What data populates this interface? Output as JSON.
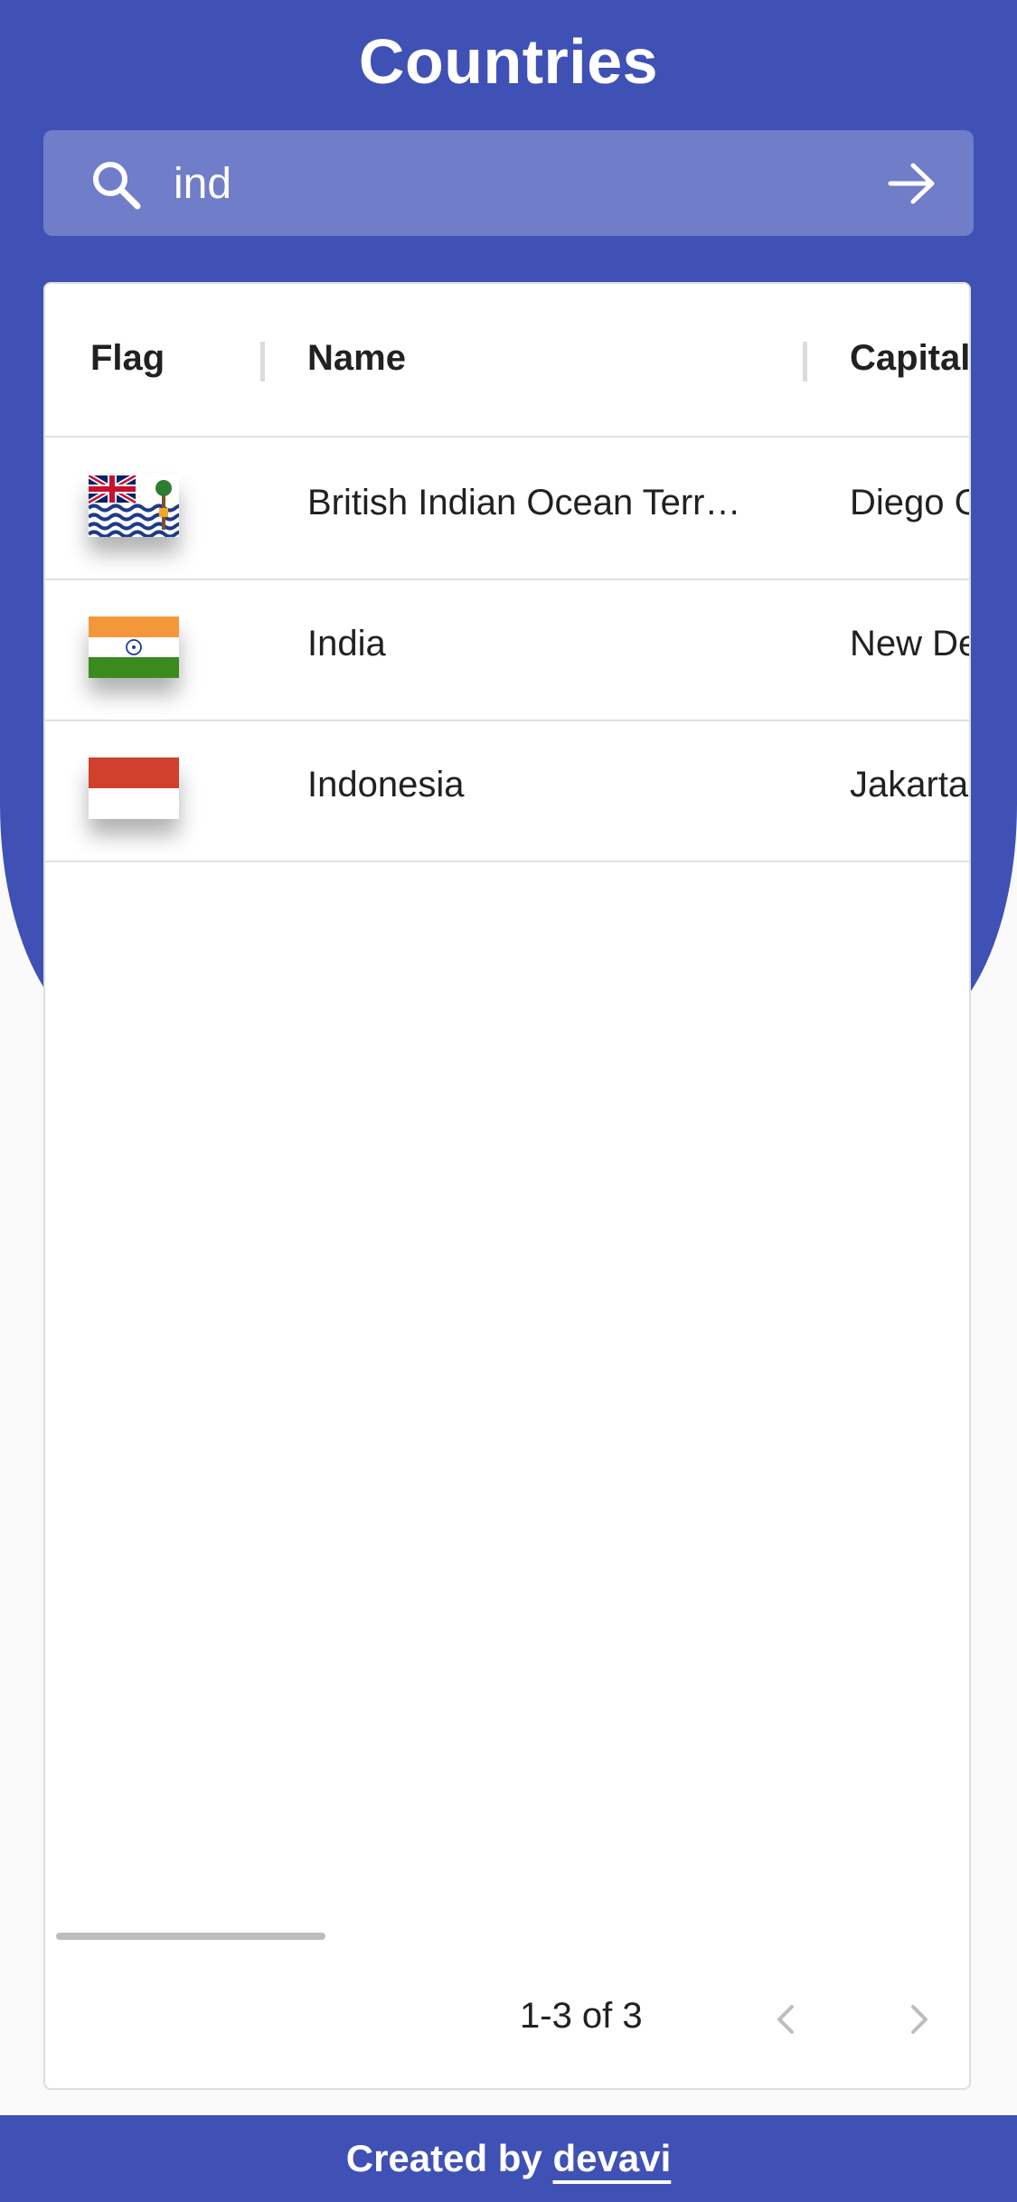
{
  "app": {
    "title": "Countries"
  },
  "search": {
    "value": "ind"
  },
  "table": {
    "columns": [
      "Flag",
      "Name",
      "Capital"
    ],
    "rows": [
      {
        "flag": "british-indian-ocean-territory-flag",
        "name": "British Indian Ocean Terr…",
        "capital": "Diego G"
      },
      {
        "flag": "india-flag",
        "name": "India",
        "capital": "New De"
      },
      {
        "flag": "indonesia-flag",
        "name": "Indonesia",
        "capital": "Jakarta"
      }
    ]
  },
  "pagination": {
    "range": "1-3 of 3"
  },
  "footer": {
    "prefix": "Created by",
    "author": "devavi"
  },
  "colors": {
    "primary": "#3f51b5",
    "search_bg": "#707dc9",
    "background": "#fafafa"
  }
}
